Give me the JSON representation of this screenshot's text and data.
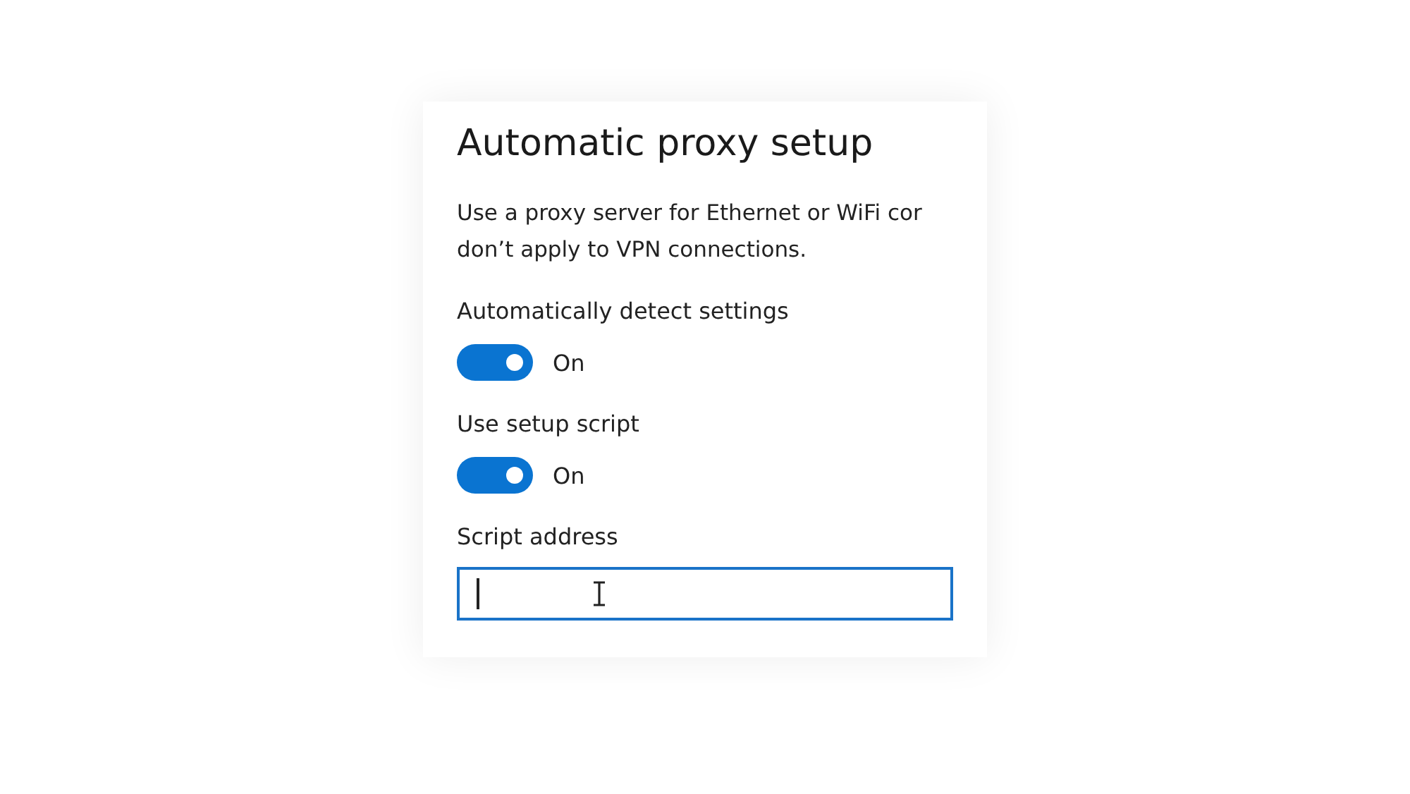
{
  "title": "Automatic proxy setup",
  "description": [
    "Use a proxy server for Ethernet or WiFi cor",
    "don’t apply to VPN connections."
  ],
  "settings": [
    {
      "label": "Automatically detect settings",
      "on": true,
      "state_text": "On"
    },
    {
      "label": "Use setup script",
      "on": true,
      "state_text": "On"
    }
  ],
  "script_address": {
    "label": "Script address",
    "focused": true
  }
}
